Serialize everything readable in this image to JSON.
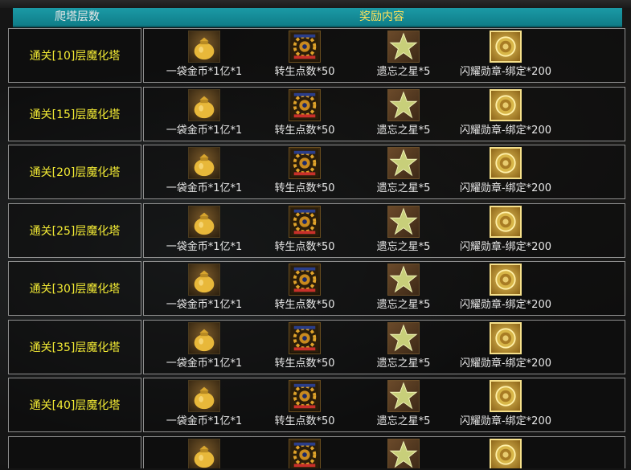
{
  "header": {
    "col1": "爬塔层数",
    "col2": "奖励内容"
  },
  "rewards": [
    {
      "label": "一袋金币*1亿*1",
      "icon": "gold-bag-icon"
    },
    {
      "label": "转生点数*50",
      "icon": "rebirth-points-icon"
    },
    {
      "label": "遗忘之星*5",
      "icon": "star-icon"
    },
    {
      "label": "闪耀勋章-绑定*200",
      "icon": "medal-icon"
    }
  ],
  "rows": [
    {
      "tier": "通关[10]层魔化塔"
    },
    {
      "tier": "通关[15]层魔化塔"
    },
    {
      "tier": "通关[20]层魔化塔"
    },
    {
      "tier": "通关[25]层魔化塔"
    },
    {
      "tier": "通关[30]层魔化塔"
    },
    {
      "tier": "通关[35]层魔化塔"
    },
    {
      "tier": "通关[40]层魔化塔"
    }
  ],
  "colors": {
    "header_bg": "#1b9aa6",
    "header_text": "#e8e8e8",
    "header_accent": "#ffe25a",
    "tier_text": "#f2ea34",
    "item_text": "#e8e8e8",
    "border": "#8e8e8e"
  }
}
